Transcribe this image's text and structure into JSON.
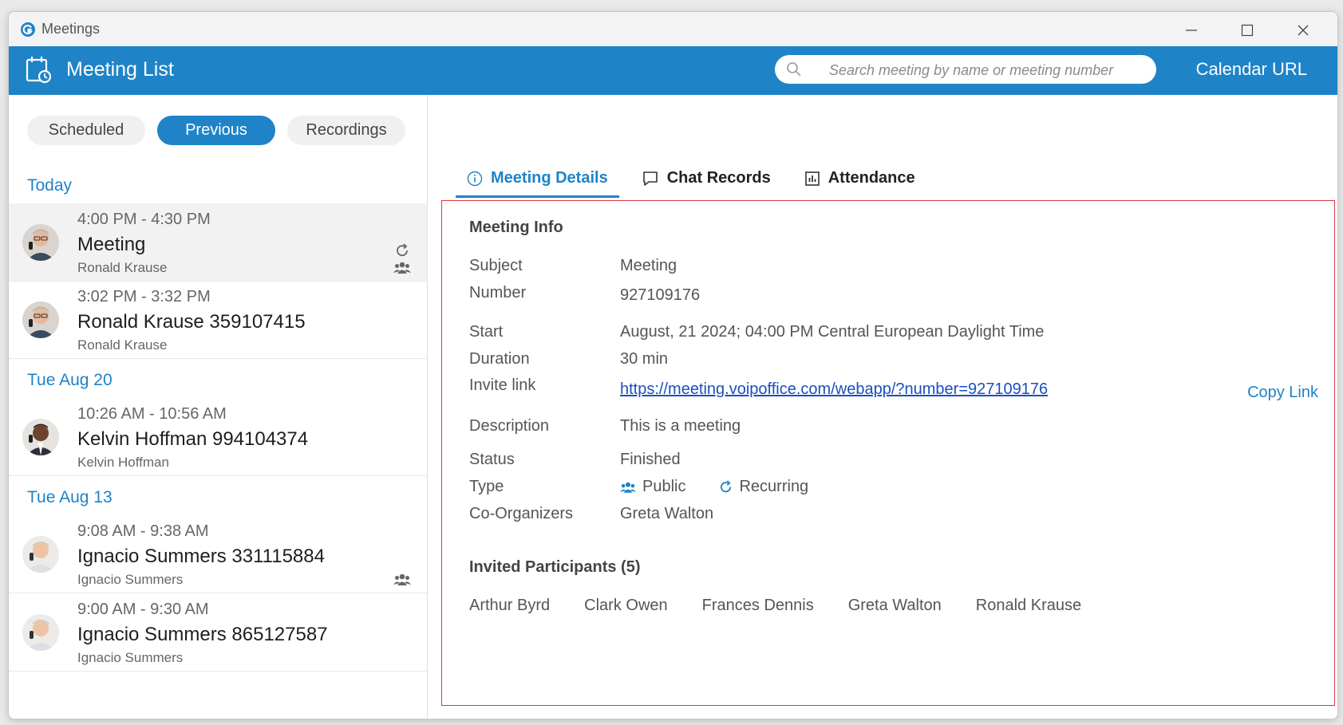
{
  "window": {
    "title": "Meetings",
    "controls": [
      "minimize",
      "maximize",
      "close"
    ]
  },
  "header": {
    "title": "Meeting List",
    "search_placeholder": "Search meeting by name or meeting number",
    "calendar_url": "Calendar URL"
  },
  "tabs": {
    "scheduled": "Scheduled",
    "previous": "Previous",
    "recordings": "Recordings",
    "active": "Previous"
  },
  "meeting_groups": [
    {
      "label": "Today",
      "items": [
        {
          "time": "4:00 PM - 4:30 PM",
          "title": "Meeting",
          "organizer": "Ronald Krause",
          "recurring": true,
          "public": true,
          "selected": true
        }
      ]
    },
    {
      "label": "",
      "items": [
        {
          "time": "3:02 PM - 3:32 PM",
          "title": "Ronald Krause 359107415",
          "organizer": "Ronald Krause",
          "recurring": false,
          "public": false,
          "selected": false
        }
      ]
    },
    {
      "label": "Tue Aug 20",
      "items": [
        {
          "time": "10:26 AM - 10:56 AM",
          "title": "Kelvin Hoffman 994104374",
          "organizer": "Kelvin Hoffman",
          "recurring": false,
          "public": false,
          "selected": false
        }
      ]
    },
    {
      "label": "Tue Aug 13",
      "items": [
        {
          "time": "9:08 AM - 9:38 AM",
          "title": "Ignacio Summers 331115884",
          "organizer": "Ignacio Summers",
          "recurring": false,
          "public": true,
          "selected": false
        },
        {
          "time": "9:00 AM - 9:30 AM",
          "title": "Ignacio Summers 865127587",
          "organizer": "Ignacio Summers",
          "recurring": false,
          "public": false,
          "selected": false
        }
      ]
    }
  ],
  "detail_tabs": {
    "meeting_details": "Meeting Details",
    "chat_records": "Chat Records",
    "attendance": "Attendance",
    "active": "Meeting Details"
  },
  "meeting_info": {
    "section_title": "Meeting Info",
    "subject_label": "Subject",
    "subject": "Meeting",
    "number_label": "Number",
    "number": "927109176",
    "start_label": "Start",
    "start": "August, 21 2024; 04:00 PM Central European Daylight Time",
    "duration_label": "Duration",
    "duration": "30 min",
    "invite_label": "Invite link",
    "invite_link": "https://meeting.voipoffice.com/webapp/?number=927109176",
    "copy_link": "Copy Link",
    "description_label": "Description",
    "description": "This is a meeting",
    "status_label": "Status",
    "status": "Finished",
    "type_label": "Type",
    "type_public": "Public",
    "type_recurring": "Recurring",
    "coorg_label": "Co-Organizers",
    "coorganizers": "Greta Walton"
  },
  "participants": {
    "title": "Invited Participants (5)",
    "names": [
      "Arthur Byrd",
      "Clark Owen",
      "Frances Dennis",
      "Greta Walton",
      "Ronald Krause"
    ]
  },
  "colors": {
    "accent": "#1f83c7",
    "highlight_border": "#e0353f",
    "link": "#1a4fc0"
  }
}
